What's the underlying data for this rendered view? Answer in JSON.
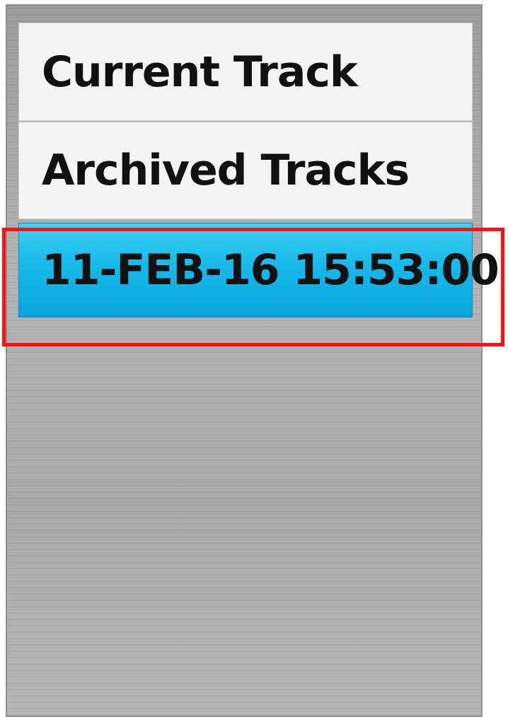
{
  "menu": {
    "items": [
      {
        "label": "Current Track",
        "selected": false
      },
      {
        "label": "Archived Tracks",
        "selected": false
      },
      {
        "label": "11-FEB-16 15:53:00",
        "selected": true
      }
    ]
  },
  "colors": {
    "selected_accent": "#16b9ea",
    "highlight_box": "#ff1010",
    "item_background": "#f4f4f4"
  }
}
